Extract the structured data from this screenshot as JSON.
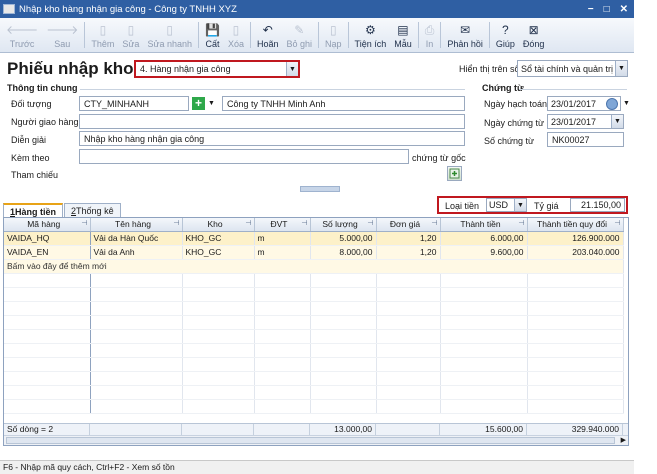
{
  "window": {
    "title": "Nhập kho hàng nhận gia công - Công ty TNHH XYZ",
    "minimize": "−",
    "maximize": "□",
    "close": "✕"
  },
  "toolbar": [
    {
      "label": "Trước",
      "icon": "arrow-left-icon",
      "glyph": "🡐",
      "disabled": true
    },
    {
      "label": "Sau",
      "icon": "arrow-right-icon",
      "glyph": "🡒",
      "disabled": true
    },
    {
      "label": "Thêm",
      "icon": "add-icon",
      "glyph": "▯",
      "disabled": true
    },
    {
      "label": "Sửa",
      "icon": "edit-icon",
      "glyph": "▯",
      "disabled": true
    },
    {
      "label": "Sửa nhanh",
      "icon": "quick-edit-icon",
      "glyph": "▯",
      "disabled": true
    },
    {
      "label": "Cất",
      "icon": "save-icon",
      "glyph": "💾",
      "disabled": false
    },
    {
      "label": "Xóa",
      "icon": "delete-icon",
      "glyph": "▯",
      "disabled": true
    },
    {
      "label": "Hoãn",
      "icon": "undo-icon",
      "glyph": "↶",
      "disabled": false
    },
    {
      "label": "Bỏ ghi",
      "icon": "unpost-icon",
      "glyph": "✎",
      "disabled": true
    },
    {
      "label": "Nạp",
      "icon": "reload-icon",
      "glyph": "▯",
      "disabled": true
    },
    {
      "label": "Tiện ích",
      "icon": "utilities-icon",
      "glyph": "⚙",
      "disabled": false,
      "dropdown": true
    },
    {
      "label": "Mẫu",
      "icon": "template-icon",
      "glyph": "▤",
      "disabled": false,
      "dropdown": true
    },
    {
      "label": "In",
      "icon": "print-icon",
      "glyph": "⎙",
      "disabled": true,
      "dropdown": true
    },
    {
      "label": "Phản hồi",
      "icon": "feedback-icon",
      "glyph": "✉",
      "disabled": false
    },
    {
      "label": "Giúp",
      "icon": "help-icon",
      "glyph": "?",
      "disabled": false
    },
    {
      "label": "Đóng",
      "icon": "close-icon",
      "glyph": "⊠",
      "disabled": false
    }
  ],
  "header": {
    "title": "Phiếu nhập kho",
    "voucher_type": "4. Hàng nhận gia công",
    "view_label": "Hiển thị trên sổ",
    "view_value": "Sổ tài chính và quản trị"
  },
  "general": {
    "section": "Thông tin chung",
    "object_label": "Đối tượng",
    "object_code": "CTY_MINHANH",
    "object_name": "Công ty TNHH Minh Anh",
    "deliverer_label": "Người giao hàng",
    "deliverer_value": "",
    "description_label": "Diễn giải",
    "description_value": "Nhập kho hàng nhận gia công",
    "attach_label": "Kèm theo",
    "attach_value": "",
    "attach_suffix": "chứng từ gốc",
    "reference_label": "Tham chiếu"
  },
  "voucher": {
    "section": "Chứng từ",
    "posting_date_label": "Ngày hạch toán",
    "posting_date": "23/01/2017",
    "voucher_date_label": "Ngày chứng từ",
    "voucher_date": "23/01/2017",
    "number_label": "Số chứng từ",
    "number": "NK00027"
  },
  "tabs": [
    {
      "key": "1",
      "label": " Hàng tiền",
      "active": true
    },
    {
      "key": "2",
      "label": " Thống kê",
      "active": false
    }
  ],
  "currency": {
    "label": "Loại tiền",
    "value": "USD",
    "rate_label": "Tỷ giá",
    "rate": "21.150,00"
  },
  "grid": {
    "columns": [
      "Mã hàng",
      "Tên hàng",
      "Kho",
      "ĐVT",
      "Số lượng",
      "Đơn giá",
      "Thành tiền",
      "Thành tiền quy đổi"
    ],
    "rows": [
      [
        "VAIDA_HQ",
        "Vải da Hàn Quốc",
        "KHO_GC",
        "m",
        "5.000,00",
        "1,20",
        "6.000,00",
        "126.900.000"
      ],
      [
        "VAIDA_EN",
        "Vải da Anh",
        "KHO_GC",
        "m",
        "8.000,00",
        "1,20",
        "9.600,00",
        "203.040.000"
      ]
    ],
    "new_row_hint": "Bấm vào đây để thêm mới",
    "footer": {
      "row_count": "Số dòng = 2",
      "total_qty": "13.000,00",
      "total_amount": "15.600,00",
      "total_converted": "329.940.000"
    }
  },
  "status": "F6 - Nhập mã quy cách, Ctrl+F2 - Xem số tồn"
}
